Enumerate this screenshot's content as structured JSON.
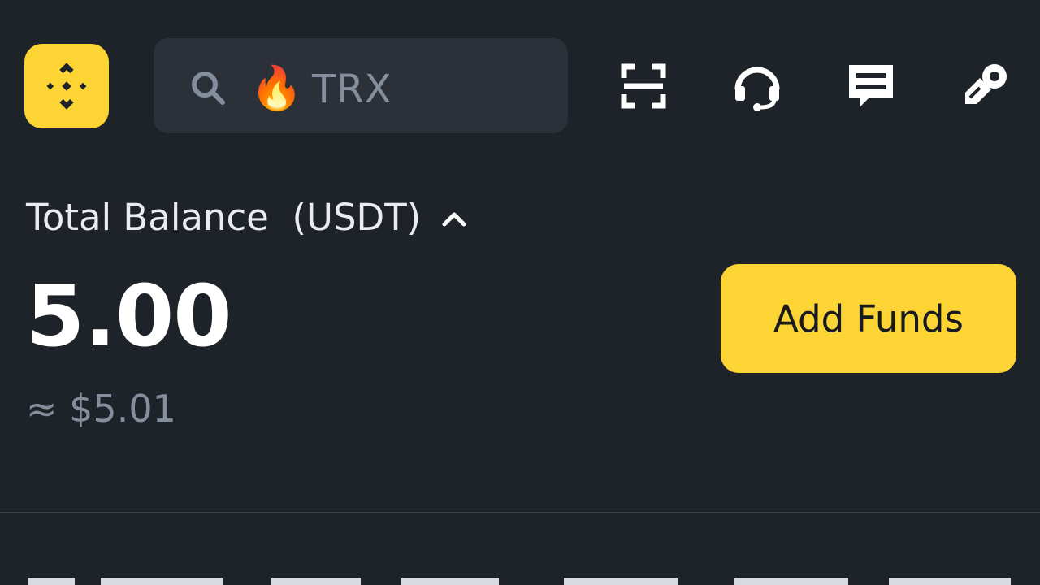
{
  "header": {
    "logo": "binance-logo-icon",
    "search": {
      "icons": [
        "search-icon",
        "fire-icon"
      ],
      "trending_emoji": "🔥",
      "placeholder": "TRX"
    },
    "actions": [
      "scan-icon",
      "customer-support-icon",
      "messages-icon",
      "referral-icon"
    ]
  },
  "balance": {
    "label": "Total Balance  (USDT)",
    "value": "5.00",
    "fiat_equivalent": "≈ $5.01"
  },
  "add_funds": {
    "label": "Add Funds"
  },
  "colors": {
    "background": "#1e2229",
    "accent": "#fcd535",
    "search_bg": "#2b3039",
    "muted_text": "#848e9c"
  }
}
